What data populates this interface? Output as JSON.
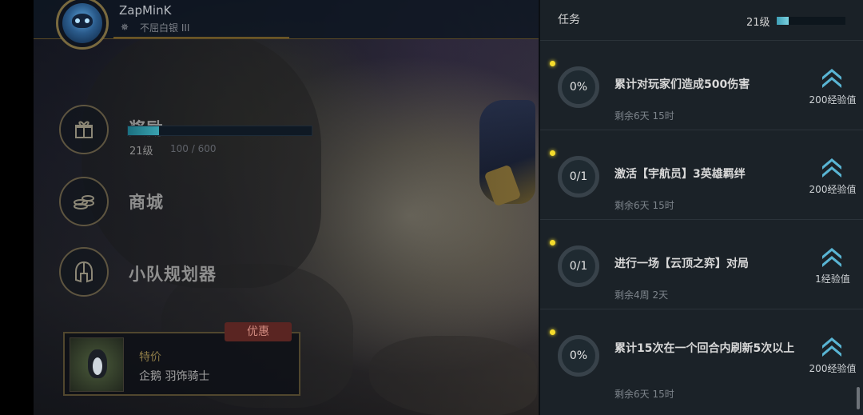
{
  "profile": {
    "username": "ZapMinK",
    "rank_icon": "rank-emblem-icon",
    "rank": "不屈白银 III"
  },
  "menu": {
    "reward": {
      "label": "奖励",
      "icon": "gift-icon",
      "level": "21级",
      "xp": "100 / 600",
      "progress_fraction": 0.17
    },
    "shop": {
      "label": "商城",
      "icon": "coins-icon"
    },
    "planner": {
      "label": "小队规划器",
      "icon": "helmet-icon"
    }
  },
  "promo": {
    "badge": "优惠",
    "tag": "特价",
    "name": "企鹅 羽饰骑士"
  },
  "missions": {
    "title": "任务",
    "level": "21级",
    "progress_fraction": 0.18,
    "items": [
      {
        "progress": "0%",
        "title": "累计对玩家们造成500伤害",
        "time": "剩余6天 15时",
        "reward": "200经验值"
      },
      {
        "progress": "0/1",
        "title": "激活【宇航员】3英雄羁绊",
        "time": "剩余6天 15时",
        "reward": "200经验值"
      },
      {
        "progress": "0/1",
        "title": "进行一场【云顶之弈】对局",
        "time": "剩余4周 2天",
        "reward": "1经验值"
      },
      {
        "progress": "0%",
        "title": "累计15次在一个回合内刷新5次以上",
        "time": "剩余6天 15时",
        "reward": "200经验值"
      }
    ]
  },
  "colors": {
    "accent_teal": "#3aa2b0",
    "gold_border": "#7a6a3f",
    "promo_red": "#5a2522",
    "quest_dot": "#f4dc2c"
  }
}
